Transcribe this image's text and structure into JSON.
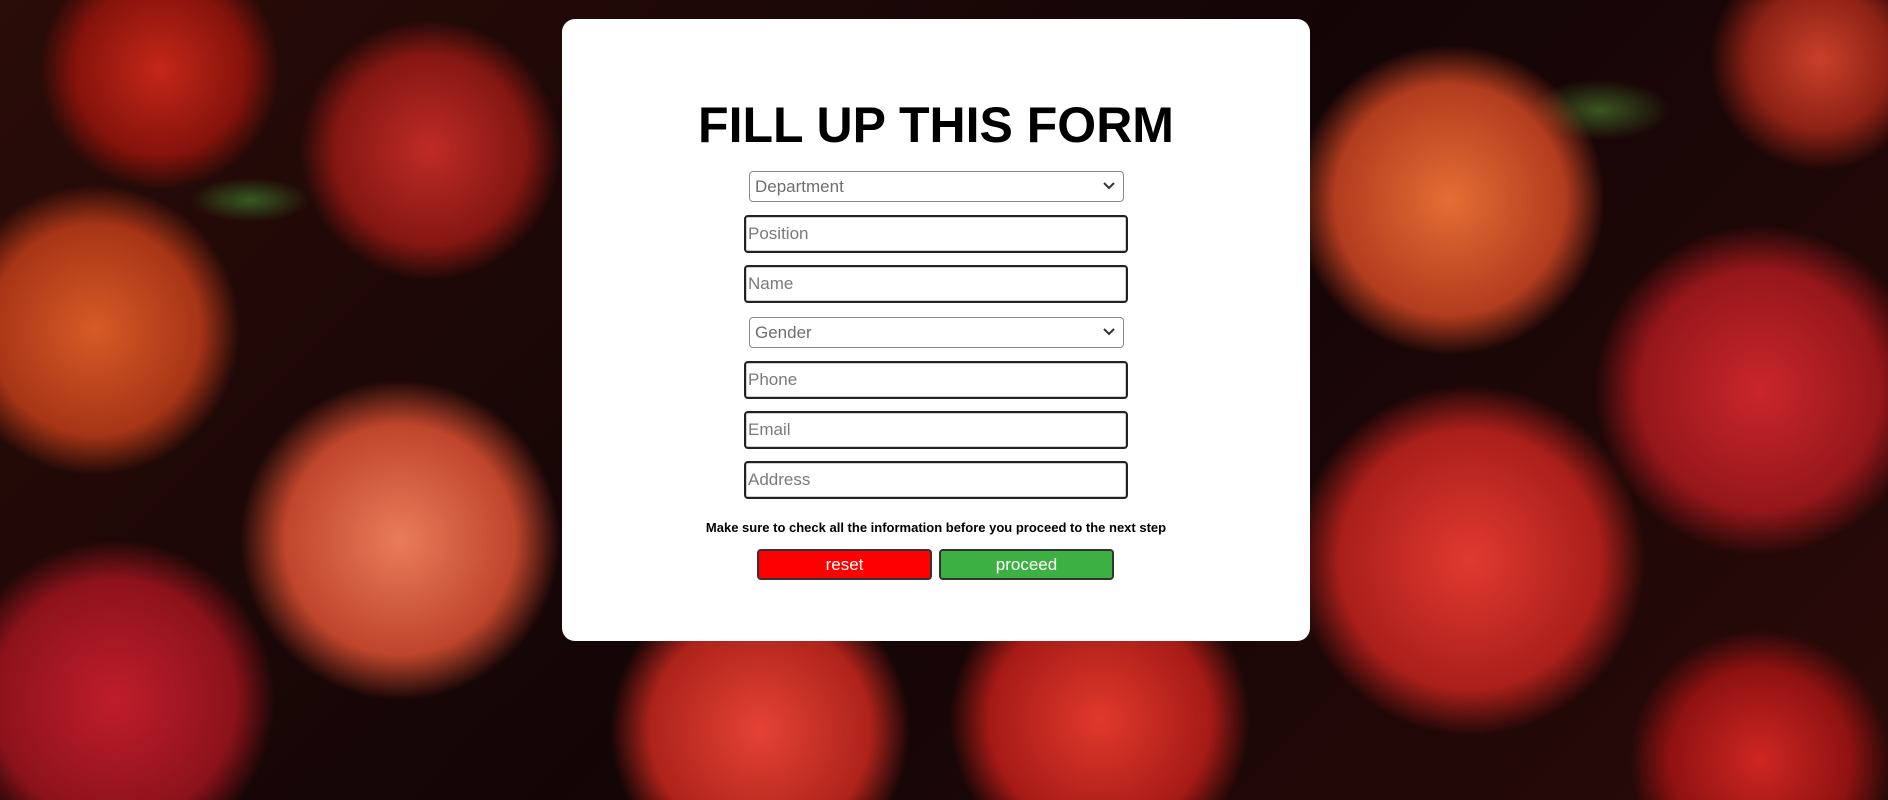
{
  "form": {
    "title": "FILL UP THIS FORM",
    "department": {
      "selected": "Department"
    },
    "position": {
      "placeholder": "Position"
    },
    "name": {
      "placeholder": "Name"
    },
    "gender": {
      "selected": "Gender"
    },
    "phone": {
      "placeholder": "Phone"
    },
    "email": {
      "placeholder": "Email"
    },
    "address": {
      "placeholder": "Address"
    },
    "note": "Make sure to check all the information before you proceed to the next step",
    "reset_label": "reset",
    "proceed_label": "proceed"
  },
  "colors": {
    "reset": "#ff0000",
    "proceed": "#3cb043",
    "card": "#ffffff"
  },
  "background": {
    "description_icon": "rambutan-photo-background"
  }
}
